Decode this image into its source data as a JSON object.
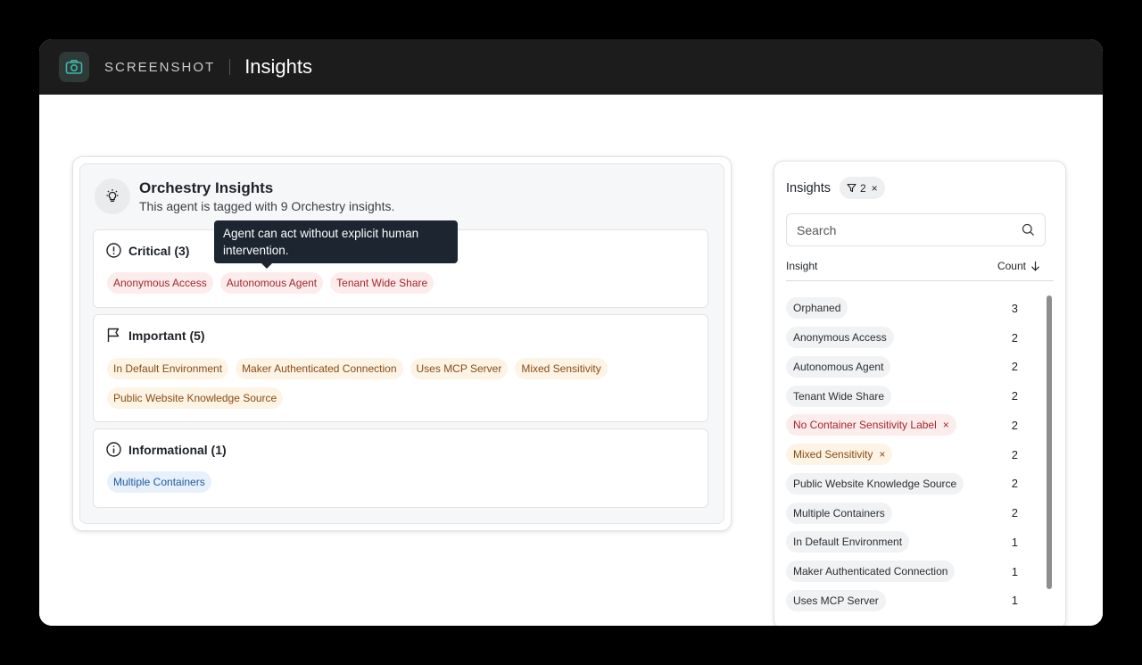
{
  "app": {
    "brand": "SCREENSHOT",
    "title": "Insights",
    "icon": "camera-icon"
  },
  "card": {
    "title": "Orchestry Insights",
    "subtitle": "This agent is tagged with 9 Orchestry insights.",
    "icon": "lightbulb-icon"
  },
  "sections": {
    "critical": {
      "label": "Critical (3)",
      "chips": [
        "Anonymous Access",
        "Autonomous Agent",
        "Tenant Wide Share"
      ]
    },
    "important": {
      "label": "Important (5)",
      "chips": [
        "In Default Environment",
        "Maker Authenticated Connection",
        "Uses MCP Server",
        "Mixed Sensitivity",
        "Public Website Knowledge Source"
      ]
    },
    "informational": {
      "label": "Informational (1)",
      "chips": [
        "Multiple Containers"
      ]
    }
  },
  "tooltip": {
    "text": "Agent can act without explicit human intervention."
  },
  "panel": {
    "title": "Insights",
    "filter_count": "2",
    "filter_clear": "×",
    "search_placeholder": "Search",
    "col_insight": "Insight",
    "col_count": "Count",
    "rows": [
      {
        "label": "Orphaned",
        "count": "3"
      },
      {
        "label": "Anonymous Access",
        "count": "2"
      },
      {
        "label": "Autonomous Agent",
        "count": "2"
      },
      {
        "label": "Tenant Wide Share",
        "count": "2"
      },
      {
        "label": "No Container Sensitivity Label",
        "count": "2",
        "remove": "×"
      },
      {
        "label": "Mixed Sensitivity",
        "count": "2",
        "remove": "×"
      },
      {
        "label": "Public Website Knowledge Source",
        "count": "2"
      },
      {
        "label": "Multiple Containers",
        "count": "2"
      },
      {
        "label": "In Default Environment",
        "count": "1"
      },
      {
        "label": "Maker Authenticated Connection",
        "count": "1"
      },
      {
        "label": "Uses MCP Server",
        "count": "1"
      }
    ]
  },
  "colors": {
    "critical": "#a4262c",
    "important": "#8a4b0f",
    "informational": "#1f5aa6",
    "accent": "#3fb6a8"
  }
}
